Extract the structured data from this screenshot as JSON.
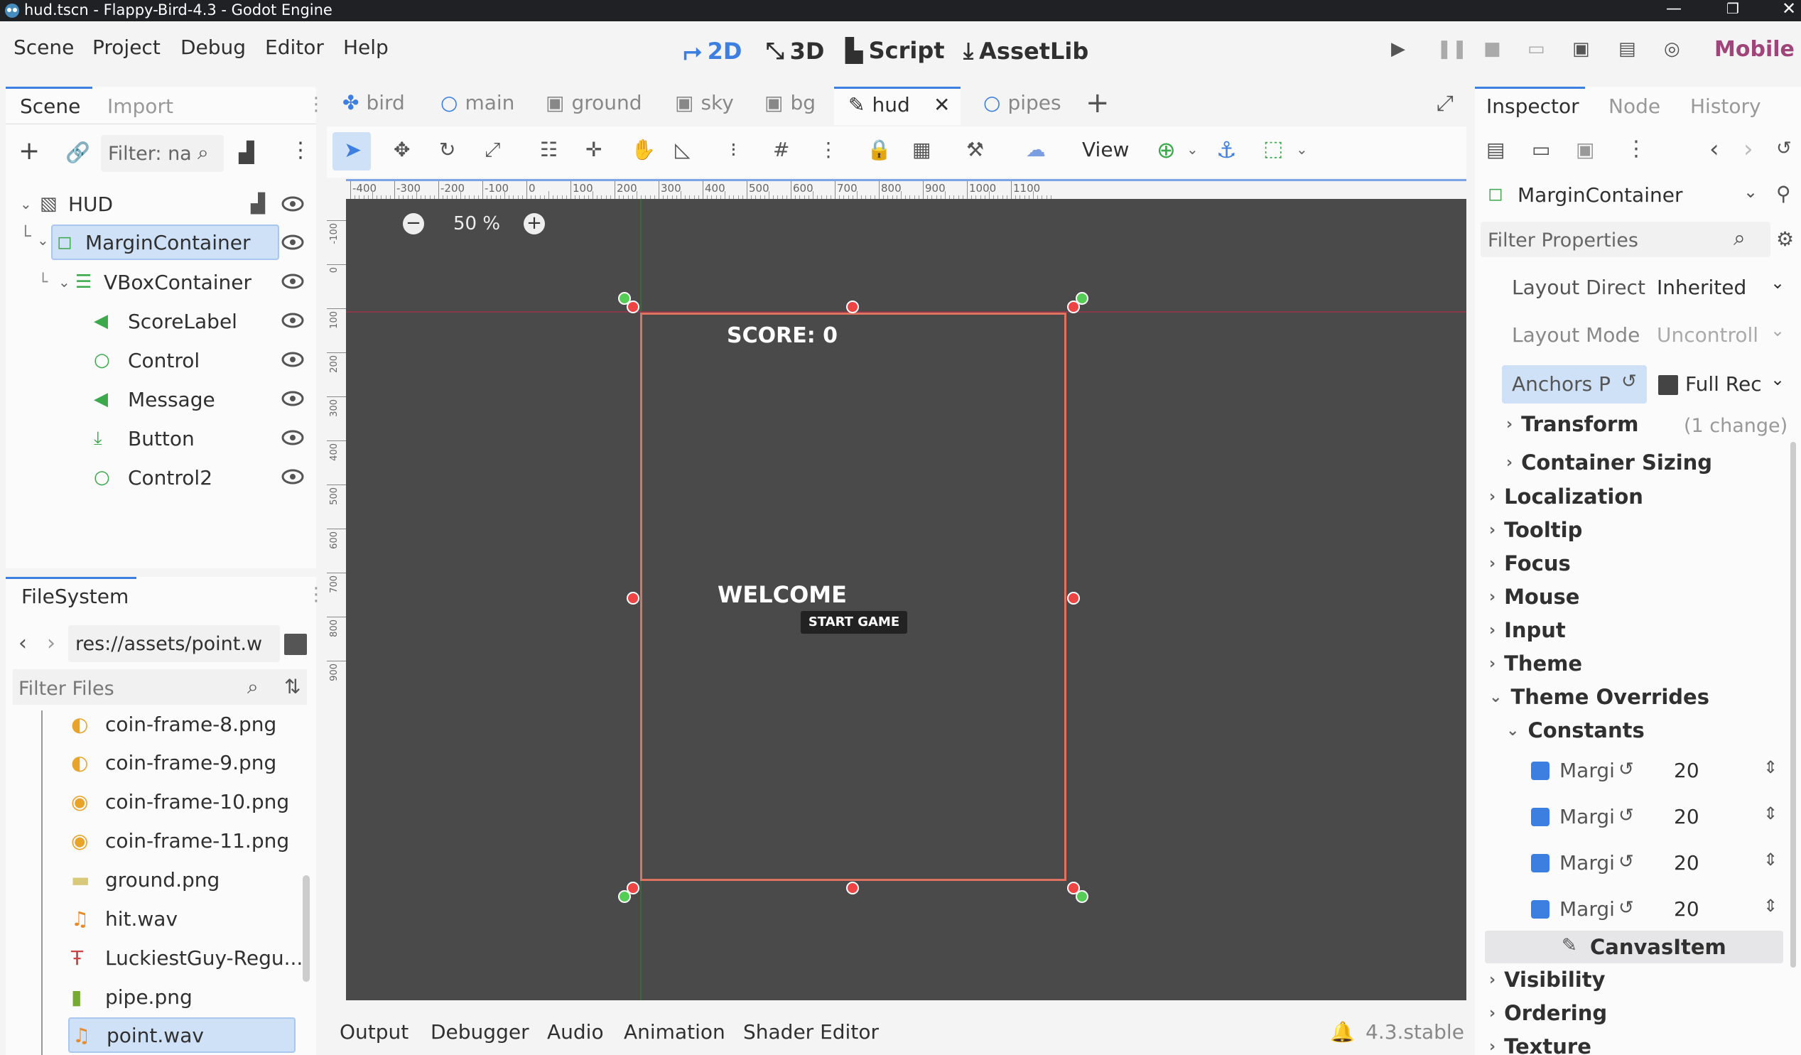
{
  "title": "hud.tscn - Flappy-Bird-4.3 - Godot Engine",
  "menus": [
    "Scene",
    "Project",
    "Debug",
    "Editor",
    "Help"
  ],
  "workspaces": [
    "2D",
    "3D",
    "Script",
    "AssetLib"
  ],
  "renderer": "Mobile",
  "scene_panel": {
    "tabs": [
      "Scene",
      "Import"
    ],
    "filter_placeholder": "Filter: na",
    "nodes": [
      {
        "label": "HUD",
        "icon": "canvas-layer-icon"
      },
      {
        "label": "MarginContainer",
        "icon": "margin-container-icon"
      },
      {
        "label": "VBoxContainer",
        "icon": "vbox-container-icon"
      },
      {
        "label": "ScoreLabel",
        "icon": "label-icon"
      },
      {
        "label": "Control",
        "icon": "control-icon"
      },
      {
        "label": "Message",
        "icon": "label-icon"
      },
      {
        "label": "Button",
        "icon": "button-icon"
      },
      {
        "label": "Control2",
        "icon": "control-icon"
      }
    ]
  },
  "filesystem": {
    "tab": "FileSystem",
    "path": "res://assets/point.w",
    "filter_placeholder": "Filter Files",
    "files": [
      "coin-frame-8.png",
      "coin-frame-9.png",
      "coin-frame-10.png",
      "coin-frame-11.png",
      "ground.png",
      "hit.wav",
      "LuckiestGuy-Regu...",
      "pipe.png",
      "point.wav"
    ]
  },
  "editor_tabs": [
    "bird",
    "main",
    "ground",
    "sky",
    "bg",
    "hud",
    "pipes"
  ],
  "toolbar": {
    "view_label": "View"
  },
  "zoom": "50 %",
  "ruler_labels": [
    "-400",
    "-300",
    "-200",
    "-100",
    "0",
    "100",
    "200",
    "300",
    "400",
    "500",
    "600",
    "700",
    "800",
    "900",
    "1000",
    "1100"
  ],
  "ruler_v_labels": [
    "-100",
    "0",
    "100",
    "200",
    "300",
    "400",
    "500",
    "600",
    "700",
    "800",
    "900"
  ],
  "game": {
    "score": "SCORE: 0",
    "message": "WELCOME",
    "button": "START GAME"
  },
  "bottom_tabs": [
    "Output",
    "Debugger",
    "Audio",
    "Animation",
    "Shader Editor"
  ],
  "version": "4.3.stable",
  "inspector": {
    "tabs": [
      "Inspector",
      "Node",
      "History"
    ],
    "node_type": "MarginContainer",
    "filter_placeholder": "Filter Properties",
    "props": [
      {
        "label": "Layout Direct",
        "value": "Inherited"
      },
      {
        "label": "Layout Mode",
        "value": "Uncontroll"
      },
      {
        "label": "Anchors P",
        "value": "Full Rec"
      }
    ],
    "transform": {
      "label": "Transform",
      "note": "(1 change)"
    },
    "container_sizing": "Container Sizing",
    "sections": [
      "Localization",
      "Tooltip",
      "Focus",
      "Mouse",
      "Input",
      "Theme",
      "Theme Overrides"
    ],
    "constants_label": "Constants",
    "margins": [
      {
        "label": "Margi",
        "value": "20"
      },
      {
        "label": "Margi",
        "value": "20"
      },
      {
        "label": "Margi",
        "value": "20"
      },
      {
        "label": "Margi",
        "value": "20"
      }
    ],
    "canvas_item": "CanvasItem",
    "canvas_sections": [
      "Visibility",
      "Ordering",
      "Texture"
    ]
  },
  "colors": {
    "accent": "#3c7fe0",
    "selection": "#cfe1f7",
    "viewport": "#4a4a4a",
    "guide": "#e0735f",
    "handle_red": "#e44",
    "handle_green": "#5c5"
  }
}
